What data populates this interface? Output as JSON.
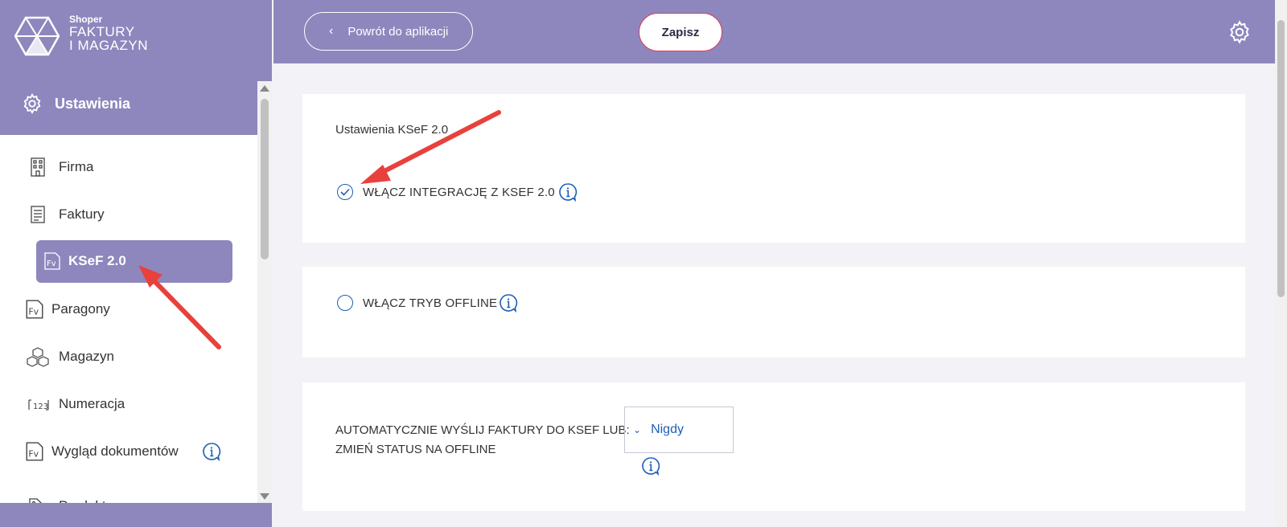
{
  "brand": {
    "small": "Shoper",
    "line1": "FAKTURY",
    "line2": "I MAGAZYN"
  },
  "sidebar": {
    "section_label": "Ustawienia",
    "items": [
      {
        "label": "Firma",
        "icon": "building-icon"
      },
      {
        "label": "Faktury",
        "icon": "document-icon"
      },
      {
        "label": "KSeF 2.0",
        "icon": "fv-icon",
        "active": true
      },
      {
        "label": "Paragony",
        "icon": "fv-icon"
      },
      {
        "label": "Magazyn",
        "icon": "boxes-icon"
      },
      {
        "label": "Numeracja",
        "icon": "numbering-icon"
      },
      {
        "label": "Wygląd dokumentów",
        "icon": "fv-icon"
      },
      {
        "label": "Produkty",
        "icon": "tag-icon"
      }
    ]
  },
  "topbar": {
    "back_label": "Powrót do aplikacji",
    "save_label": "Zapisz"
  },
  "main": {
    "card1_title": "Ustawienia KSeF 2.0",
    "integration_label": "WŁĄCZ INTEGRACJĘ Z KSEF 2.0",
    "integration_checked": true,
    "offline_label": "WŁĄCZ TRYB OFFLINE",
    "offline_checked": false,
    "auto_send_label": "AUTOMATYCZNIE WYŚLIJ FAKTURY DO KSEF LUB: ZMIEŃ STATUS NA OFFLINE",
    "auto_send_value": "Nigdy"
  },
  "colors": {
    "accent": "#8e87bd",
    "link": "#1d5fb5",
    "save_border": "#e03a57",
    "annotation_arrow": "#e8413c"
  }
}
